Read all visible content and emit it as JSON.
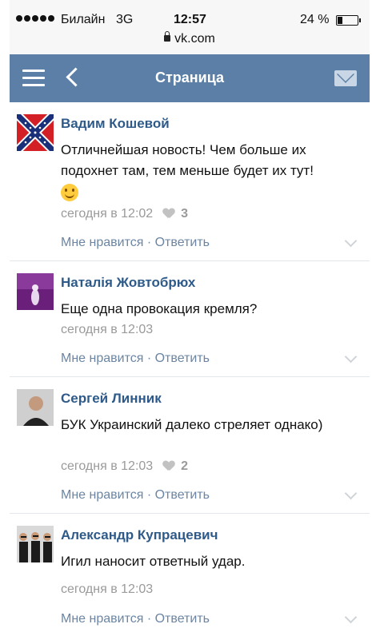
{
  "status_bar": {
    "carrier": "Билайн",
    "network": "3G",
    "time": "12:57",
    "battery_percent": "24 %",
    "url": "vk.com"
  },
  "header": {
    "title": "Страница",
    "menu_icon": "hamburger-icon",
    "back_icon": "chevron-left-icon",
    "mail_icon": "envelope-icon"
  },
  "comments": [
    {
      "author": "Вадим Кошевой",
      "text": "Отличнейшая новость! Чем больше их подохнет там, тем меньше будет их тут!",
      "has_emoji": true,
      "time": "сегодня в 12:02",
      "likes": "3",
      "actions": "Мне нравится · Ответить"
    },
    {
      "author": "Наталія Жовтобрюх",
      "text": "Еще одна провокация кремля?",
      "time": "сегодня в 12:03",
      "likes": "",
      "actions": "Мне нравится · Ответить"
    },
    {
      "author": "Сергей Линник",
      "text": "БУК Украинский далеко стреляет однако)",
      "time": "сегодня в 12:03",
      "likes": "2",
      "actions": "Мне нравится · Ответить"
    },
    {
      "author": "Александр Купрацевич",
      "text": "Игил наносит ответный удар.",
      "time": "сегодня в 12:03",
      "likes": "",
      "actions": "Мне нравится · Ответить"
    }
  ],
  "colors": {
    "header_bg": "#5b7fa6",
    "author": "#2e5a8a",
    "action_link": "#6b85a3",
    "meta": "#9a9a9a"
  }
}
